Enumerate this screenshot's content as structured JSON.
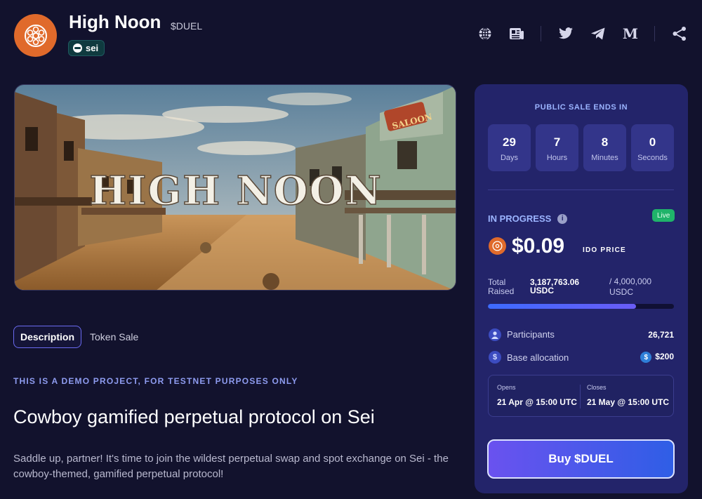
{
  "project": {
    "name": "High Noon",
    "ticker": "$DUEL",
    "chain": "sei"
  },
  "social_icons": [
    "globe-icon",
    "docs-icon",
    "twitter-icon",
    "telegram-icon",
    "medium-icon",
    "share-icon"
  ],
  "social": {
    "medium_label": "M"
  },
  "banner": {
    "logo_text": "HIGH NOON",
    "sign_text": "SALOON"
  },
  "tabs": [
    {
      "label": "Description",
      "active": true
    },
    {
      "label": "Token Sale",
      "active": false
    }
  ],
  "content": {
    "notice": "THIS IS A DEMO PROJECT, FOR TESTNET PURPOSES ONLY",
    "headline": "Cowboy gamified perpetual protocol on Sei",
    "description": "Saddle up, partner! It's time to join the wildest perpetual swap and spot exchange on Sei - the cowboy-themed, gamified perpetual protocol!"
  },
  "sale": {
    "ends_label": "PUBLIC SALE ENDS IN",
    "countdown": [
      {
        "value": "29",
        "unit": "Days"
      },
      {
        "value": "7",
        "unit": "Hours"
      },
      {
        "value": "8",
        "unit": "Minutes"
      },
      {
        "value": "0",
        "unit": "Seconds"
      }
    ],
    "status": "IN PROGRESS",
    "info_glyph": "i",
    "live_badge": "Live",
    "price": "$0.09",
    "price_label": "IDO PRICE",
    "total_raised_label": "Total Raised",
    "raised": "3,187,763.06 USDC",
    "goal": "/ 4,000,000 USDC",
    "progress_fraction": 0.797,
    "participants_label": "Participants",
    "participants": "26,721",
    "base_allocation_label": "Base allocation",
    "base_allocation_glyph": "$",
    "base_allocation": "$200",
    "usdc_glyph": "$",
    "opens_label": "Opens",
    "opens": "21 Apr @ 15:00 UTC",
    "closes_label": "Closes",
    "closes": "21 May @ 15:00 UTC",
    "buy_label": "Buy $DUEL"
  },
  "colors": {
    "background": "#12122d",
    "card": "#23246a",
    "accent": "#9bb4ff",
    "brand_orange": "#e06a2b",
    "live_green": "#1fb36a"
  }
}
